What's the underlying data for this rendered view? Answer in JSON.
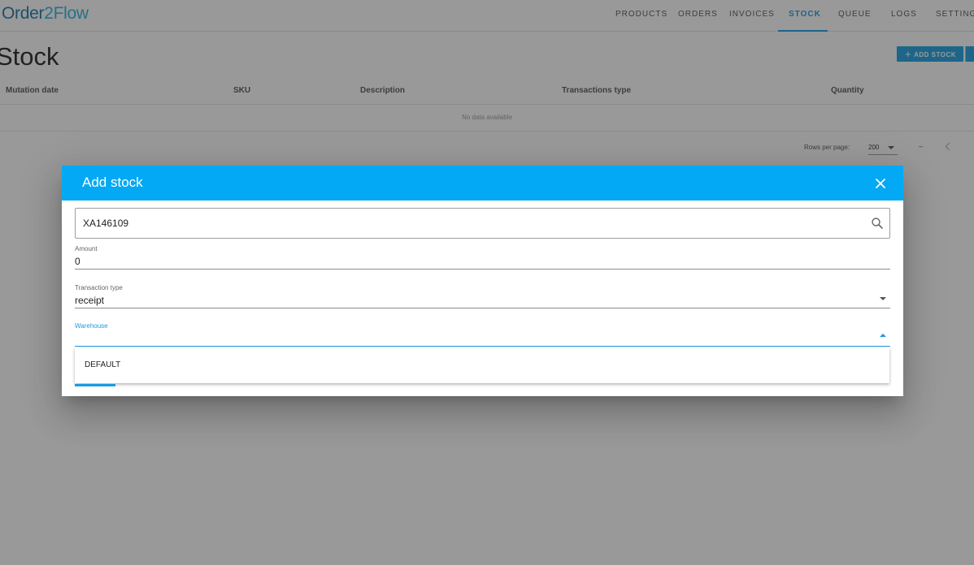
{
  "app": {
    "logo_part1": "Order",
    "logo_part2": "2Flow"
  },
  "nav": {
    "products": "PRODUCTS",
    "orders": "ORDERS",
    "invoices": "INVOICES",
    "stock": "STOCK",
    "queue": "QUEUE",
    "logs": "LOGS",
    "settings": "SETTINGS",
    "active": "STOCK"
  },
  "page": {
    "title": "Stock",
    "add_button_label": "ADD STOCK"
  },
  "table": {
    "columns": [
      "Mutation date",
      "SKU",
      "Description",
      "Transactions type",
      "Quantity"
    ],
    "empty_text": "No data available",
    "rows_per_page_label": "Rows per page:",
    "rows_per_page_value": "200",
    "page_range": "–"
  },
  "dialog": {
    "title": "Add stock",
    "search_value": "XA146109",
    "amount": {
      "label": "Amount",
      "value": "0"
    },
    "transaction_type": {
      "label": "Transaction type",
      "value": "receipt"
    },
    "warehouse": {
      "label": "Warehouse",
      "value": ""
    },
    "warehouse_options": [
      "DEFAULT"
    ]
  },
  "colors": {
    "accent": "#03a9f4",
    "brand_dark": "#1976a8",
    "brand_light": "#2bb3e3",
    "focus": "#1c9be0"
  },
  "icons": {
    "close": "close-icon",
    "search": "search-icon",
    "dropdown": "chevron-down-icon",
    "add": "plus-icon",
    "prev": "chevron-left-icon"
  }
}
